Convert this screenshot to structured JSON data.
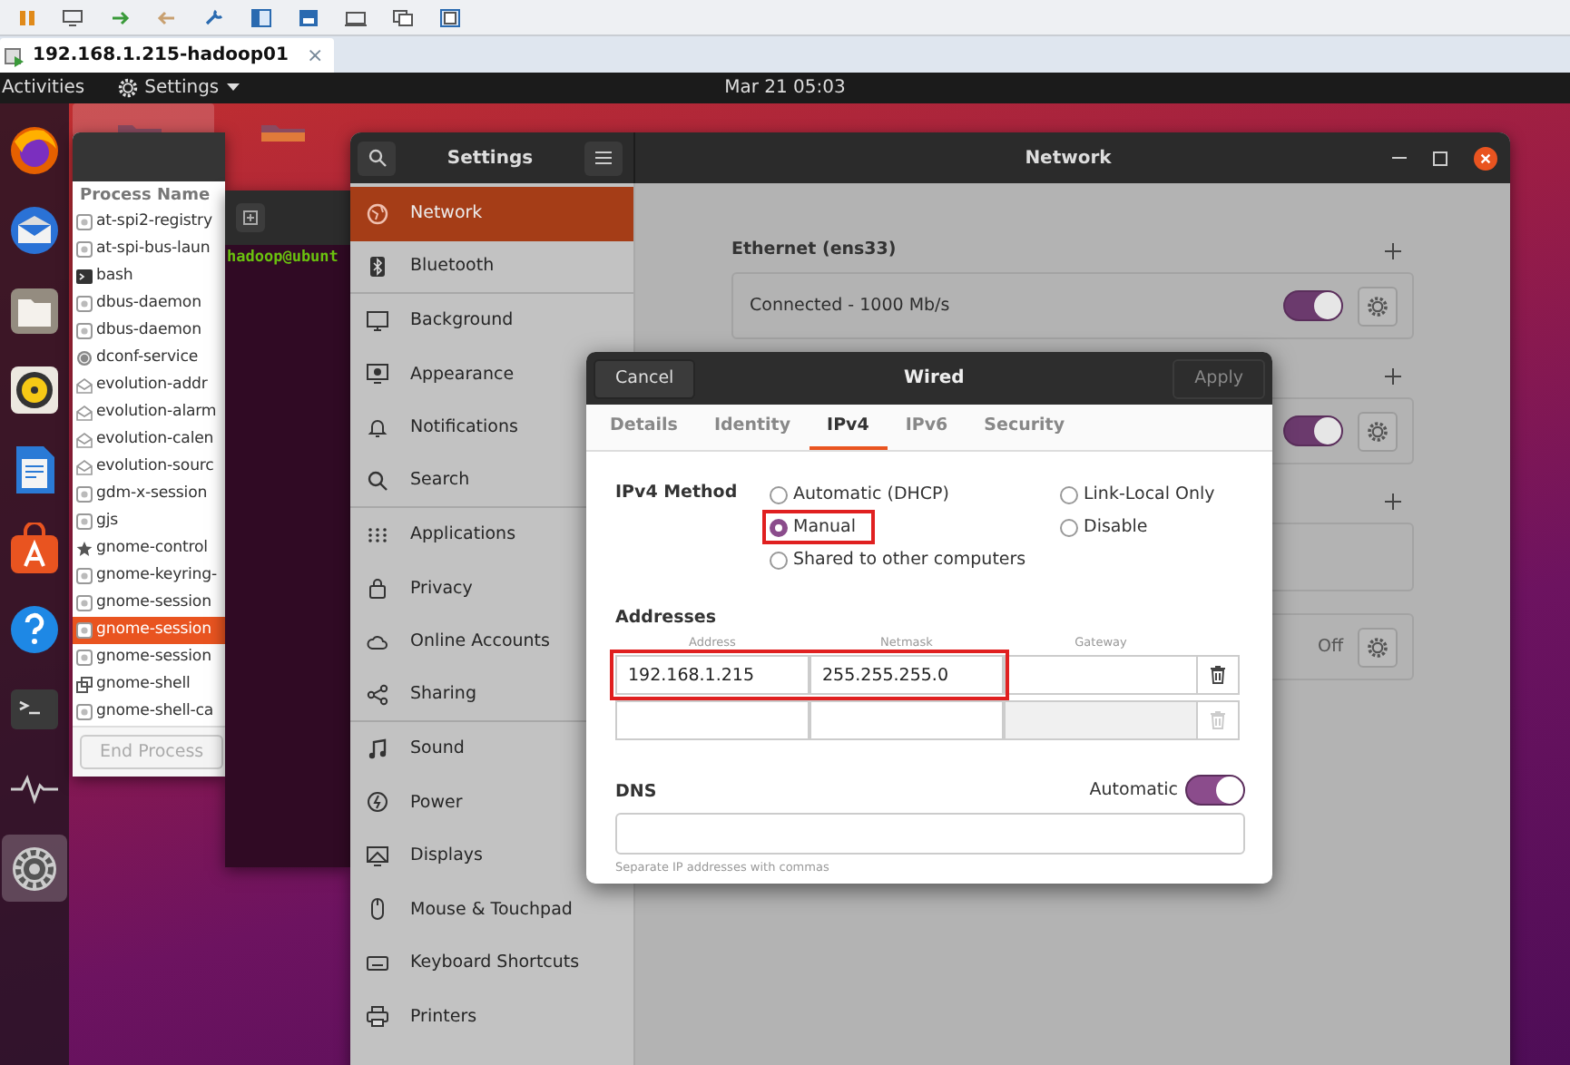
{
  "vm_tab": {
    "title": "192.168.1.215-hadoop01",
    "close": "×"
  },
  "top_bar": {
    "activities": "Activities",
    "app_menu": "Settings",
    "clock": "Mar 21  05:03"
  },
  "dock": [
    {
      "kind": "browser",
      "active": false
    },
    {
      "kind": "mail",
      "active": false
    },
    {
      "kind": "files",
      "active": false
    },
    {
      "kind": "music",
      "active": false
    },
    {
      "kind": "writer",
      "active": false
    },
    {
      "kind": "store",
      "active": false
    },
    {
      "kind": "help",
      "active": false
    },
    {
      "kind": "terminal",
      "active": false
    },
    {
      "kind": "monitor",
      "active": false
    },
    {
      "kind": "settings",
      "active": true
    }
  ],
  "process_window": {
    "column": "Process Name",
    "end_process": "End Process",
    "end_process_disabled": true,
    "processes": [
      {
        "name": "at-spi2-registry",
        "kind": "generic",
        "selected": false
      },
      {
        "name": "at-spi-bus-laun",
        "kind": "generic",
        "selected": false
      },
      {
        "name": "bash",
        "kind": "terminal",
        "selected": false
      },
      {
        "name": "dbus-daemon",
        "kind": "generic",
        "selected": false
      },
      {
        "name": "dbus-daemon",
        "kind": "generic",
        "selected": false
      },
      {
        "name": "dconf-service",
        "kind": "spiral",
        "selected": false
      },
      {
        "name": "evolution-addr",
        "kind": "mail",
        "selected": false
      },
      {
        "name": "evolution-alarm",
        "kind": "mail",
        "selected": false
      },
      {
        "name": "evolution-calen",
        "kind": "mail",
        "selected": false
      },
      {
        "name": "evolution-sourc",
        "kind": "mail",
        "selected": false
      },
      {
        "name": "gdm-x-session",
        "kind": "generic",
        "selected": false
      },
      {
        "name": "gjs",
        "kind": "generic",
        "selected": false
      },
      {
        "name": "gnome-control",
        "kind": "star",
        "selected": false
      },
      {
        "name": "gnome-keyring-",
        "kind": "generic",
        "selected": false
      },
      {
        "name": "gnome-session",
        "kind": "generic",
        "selected": false
      },
      {
        "name": "gnome-session",
        "kind": "generic",
        "selected": true
      },
      {
        "name": "gnome-session",
        "kind": "generic",
        "selected": false
      },
      {
        "name": "gnome-shell",
        "kind": "windows",
        "selected": false
      },
      {
        "name": "gnome-shell-ca",
        "kind": "generic",
        "selected": false
      }
    ]
  },
  "terminal": {
    "prompt": "hadoop@ubunt"
  },
  "settings": {
    "title": "Settings",
    "panel_title": "Network",
    "sidebar": [
      {
        "label": "Network",
        "kind": "globe",
        "selected": true,
        "separator_after": false
      },
      {
        "label": "Bluetooth",
        "kind": "bluetooth",
        "selected": false,
        "separator_after": true
      },
      {
        "label": "Background",
        "kind": "monitor",
        "selected": false,
        "separator_after": false
      },
      {
        "label": "Appearance",
        "kind": "appearance",
        "selected": false,
        "separator_after": false
      },
      {
        "label": "Notifications",
        "kind": "bell",
        "selected": false,
        "separator_after": false
      },
      {
        "label": "Search",
        "kind": "search",
        "selected": false,
        "separator_after": true
      },
      {
        "label": "Applications",
        "kind": "grid",
        "selected": false,
        "separator_after": false
      },
      {
        "label": "Privacy",
        "kind": "lock",
        "selected": false,
        "separator_after": false
      },
      {
        "label": "Online Accounts",
        "kind": "cloud",
        "selected": false,
        "separator_after": false
      },
      {
        "label": "Sharing",
        "kind": "share",
        "selected": false,
        "separator_after": true
      },
      {
        "label": "Sound",
        "kind": "note",
        "selected": false,
        "separator_after": false
      },
      {
        "label": "Power",
        "kind": "power",
        "selected": false,
        "separator_after": false
      },
      {
        "label": "Displays",
        "kind": "display",
        "selected": false,
        "separator_after": false
      },
      {
        "label": "Mouse & Touchpad",
        "kind": "mouse",
        "selected": false,
        "separator_after": false
      },
      {
        "label": "Keyboard Shortcuts",
        "kind": "keyboard",
        "selected": false,
        "separator_after": false
      },
      {
        "label": "Printers",
        "kind": "printer",
        "selected": false,
        "separator_after": false
      }
    ]
  },
  "network": {
    "sections": [
      {
        "title": "Ethernet (ens33)",
        "addable": true,
        "rows": [
          {
            "kind": "toggle",
            "label": "Connected - 1000 Mb/s",
            "on": true
          }
        ]
      },
      {
        "addable": true,
        "rows": [
          {
            "kind": "toggle",
            "on": true
          }
        ]
      },
      {
        "addable": true,
        "rows": [
          {
            "kind": "empty"
          }
        ]
      },
      {
        "addable": false,
        "rows": [
          {
            "kind": "status",
            "value": "Off"
          }
        ]
      }
    ]
  },
  "dialog": {
    "title": "Wired",
    "cancel": "Cancel",
    "apply": "Apply",
    "apply_disabled": true,
    "tabs": [
      {
        "label": "Details",
        "selected": false
      },
      {
        "label": "Identity",
        "selected": false
      },
      {
        "label": "IPv4",
        "selected": true
      },
      {
        "label": "IPv6",
        "selected": false
      },
      {
        "label": "Security",
        "selected": false
      }
    ],
    "method_label": "IPv4 Method",
    "methods": [
      {
        "label": "Automatic (DHCP)",
        "selected": false,
        "highlighted": false
      },
      {
        "label": "Manual",
        "selected": true,
        "highlighted": true
      },
      {
        "label": "Shared to other computers",
        "selected": false,
        "highlighted": false
      },
      {
        "label": "Link-Local Only",
        "selected": false,
        "highlighted": false
      },
      {
        "label": "Disable",
        "selected": false,
        "highlighted": false
      }
    ],
    "addresses_label": "Addresses",
    "columns": [
      "Address",
      "Netmask",
      "Gateway"
    ],
    "address_rows": [
      {
        "address": "192.168.1.215",
        "netmask": "255.255.255.0",
        "highlighted": true,
        "disabled": false
      },
      {
        "highlighted": false,
        "disabled": true
      }
    ],
    "dns_label": "DNS",
    "dns_auto_label": "Automatic",
    "dns_auto": true,
    "dns_hint": "Separate IP addresses with commas"
  }
}
